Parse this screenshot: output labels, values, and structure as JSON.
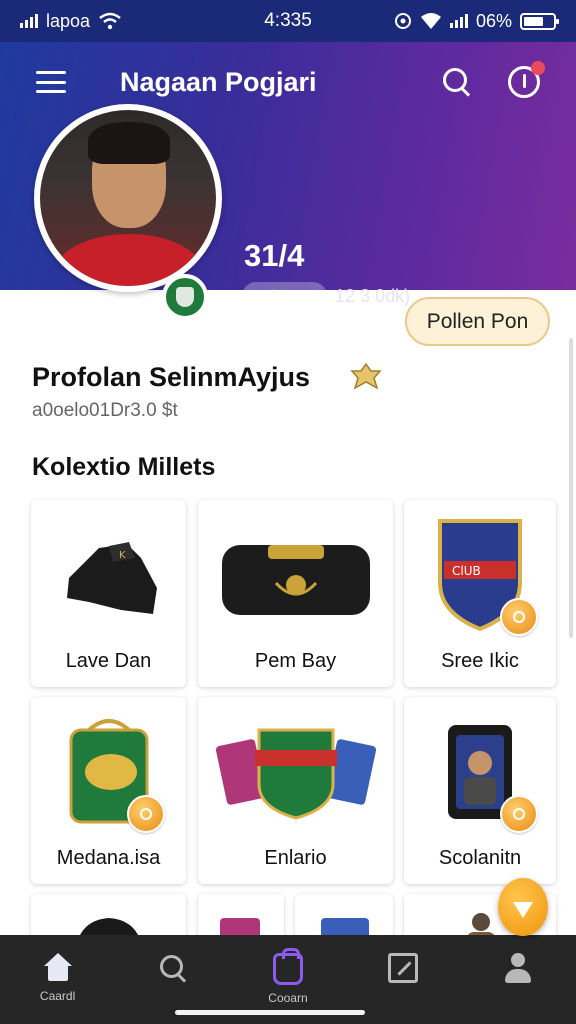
{
  "status_bar": {
    "carrier": "lapoa",
    "time": "4:335",
    "battery": "06%"
  },
  "header": {
    "title": "Nagaan Pogjari",
    "stat_value": "31/4",
    "stat_chip_label": "topan",
    "stat_detail": "12 3 0dk)"
  },
  "profile": {
    "name": "Profolan SelinmAyjus",
    "subtitle": "a0oelo01Dr3.0 $t",
    "follow_button_label": "Pollen Pon"
  },
  "collection": {
    "title": "Kolextio Millets",
    "items": [
      {
        "label": "Lave Dan",
        "icon": "boot-icon"
      },
      {
        "label": "Pem Bay",
        "icon": "bag-icon"
      },
      {
        "label": "Sree Ikic",
        "icon": "crest-icon"
      },
      {
        "label": "Medana.isa",
        "icon": "backpack-icon"
      },
      {
        "label": "Enlario",
        "icon": "cards-icon"
      },
      {
        "label": "Scolanitn",
        "icon": "card-case-icon"
      },
      {
        "label": "",
        "icon": "cap-icon"
      },
      {
        "label": "",
        "icon": "card-icon"
      },
      {
        "label": "",
        "icon": "card-icon"
      },
      {
        "label": "",
        "icon": "figure-icon"
      }
    ]
  },
  "bottom_nav": {
    "items": [
      {
        "label": "Caardl",
        "icon": "home-icon"
      },
      {
        "label": "",
        "icon": "search-icon"
      },
      {
        "label": "Cooarn",
        "icon": "collection-icon"
      },
      {
        "label": "",
        "icon": "edit-icon"
      },
      {
        "label": "",
        "icon": "profile-icon"
      }
    ]
  },
  "colors": {
    "header_start": "#1f3a9e",
    "header_end": "#7a2c9e",
    "accent_active": "#8a5cf0",
    "coin": "#f0930e",
    "nav_bg": "#262626"
  }
}
